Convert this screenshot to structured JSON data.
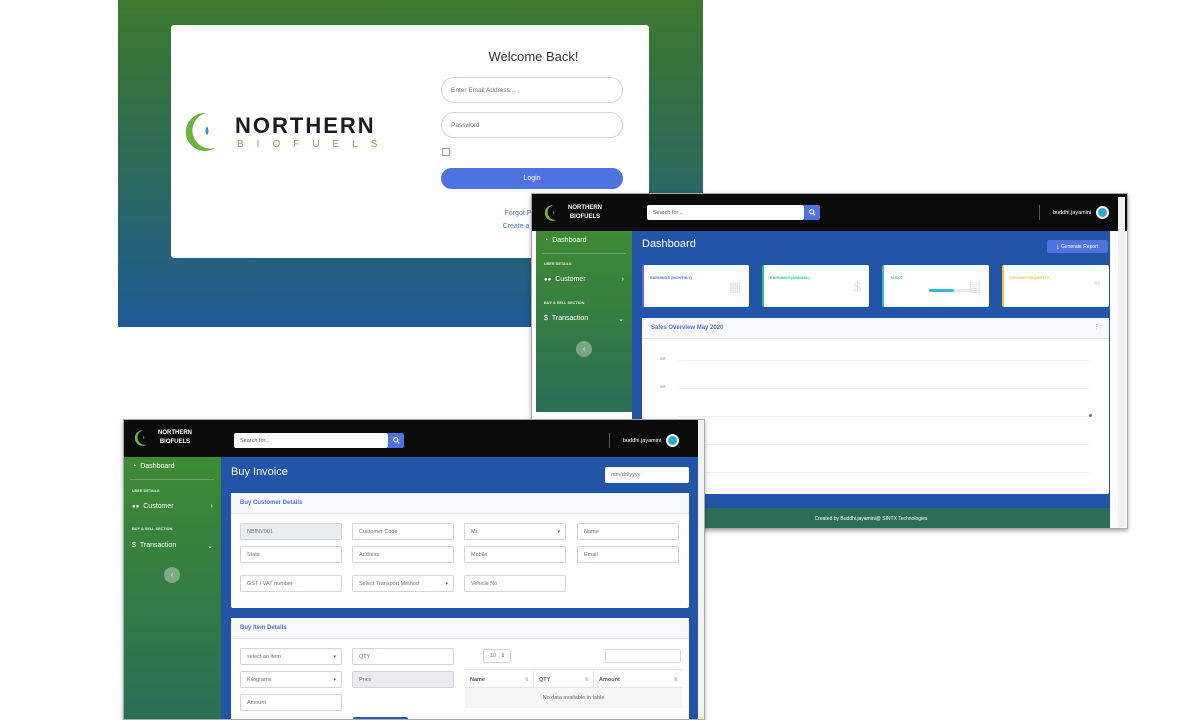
{
  "login": {
    "brand_top": "NORTHERN",
    "brand_bottom": "BIOFUELS",
    "title": "Welcome Back!",
    "email_placeholder": "Enter Email Address...",
    "password_placeholder": "Password",
    "login_label": "Login",
    "forgot_link": "Forgot P",
    "create_link": "Create a"
  },
  "dashboard": {
    "brand_line1": "NORTHERN",
    "brand_line2": "BIOFUELS",
    "search_placeholder": "Search for...",
    "user_name": "buddhi.jayamini",
    "sidebar": {
      "dashboard": "Dashboard",
      "user_details_head": "USER DETAILS",
      "customer": "Customer",
      "buy_sell_head": "BUY & SELL SECTION",
      "transaction": "Transaction"
    },
    "page_title": "Dashboard",
    "report_button": "Generate Report",
    "cards": [
      {
        "label": "EARNINGS (MONTHLY)",
        "color": "#4e73df",
        "icon": "calendar-icon"
      },
      {
        "label": "EARNINGS (ANNUAL)",
        "color": "#1cc88a",
        "icon": "dollar-icon"
      },
      {
        "label": "TASKS",
        "color": "#36b9cc",
        "icon": "clipboard-icon",
        "progress": 0.55
      },
      {
        "label": "PENDING REQUESTS",
        "color": "#f6c23e",
        "icon": "comments-icon"
      }
    ],
    "sales_title": "Sales Overview May 2020",
    "chart_ticks": [
      "INF",
      "INF"
    ],
    "footer": "Created by Buddhi.jayamini@ SINTX Technologies"
  },
  "invoice": {
    "brand_line1": "NORTHERN",
    "brand_line2": "BIOFUELS",
    "search_placeholder": "Search for...",
    "user_name": "buddhi.jayamini",
    "sidebar": {
      "dashboard": "Dashboard",
      "user_details_head": "USER DETAILS",
      "customer": "Customer",
      "buy_sell_head": "BUY & SELL SECTION",
      "transaction": "Transaction"
    },
    "page_title": "Buy Invoice",
    "date_placeholder": "mm/dd/yyyy",
    "customer_card": {
      "title": "Buy Customer Details",
      "invoice_no": "NBINV001",
      "customer_code": "Customer Code",
      "salutation": "Mr.",
      "name": "Name",
      "state": "State",
      "address": "Address",
      "mobile": "Mobile",
      "email": "Email",
      "gst": "GST / VAT number",
      "transport": "Select Transport Method",
      "vehicle": "Vehicle No"
    },
    "item_card": {
      "title": "Buy Item Details",
      "item_select": "select an item",
      "qty": "QTY",
      "unit": "Kilograms",
      "price": "Price",
      "amount": "Amount",
      "page_size": "10",
      "columns": [
        "Name",
        "QTY",
        "Amount"
      ],
      "empty_text": "No data available in table"
    }
  }
}
